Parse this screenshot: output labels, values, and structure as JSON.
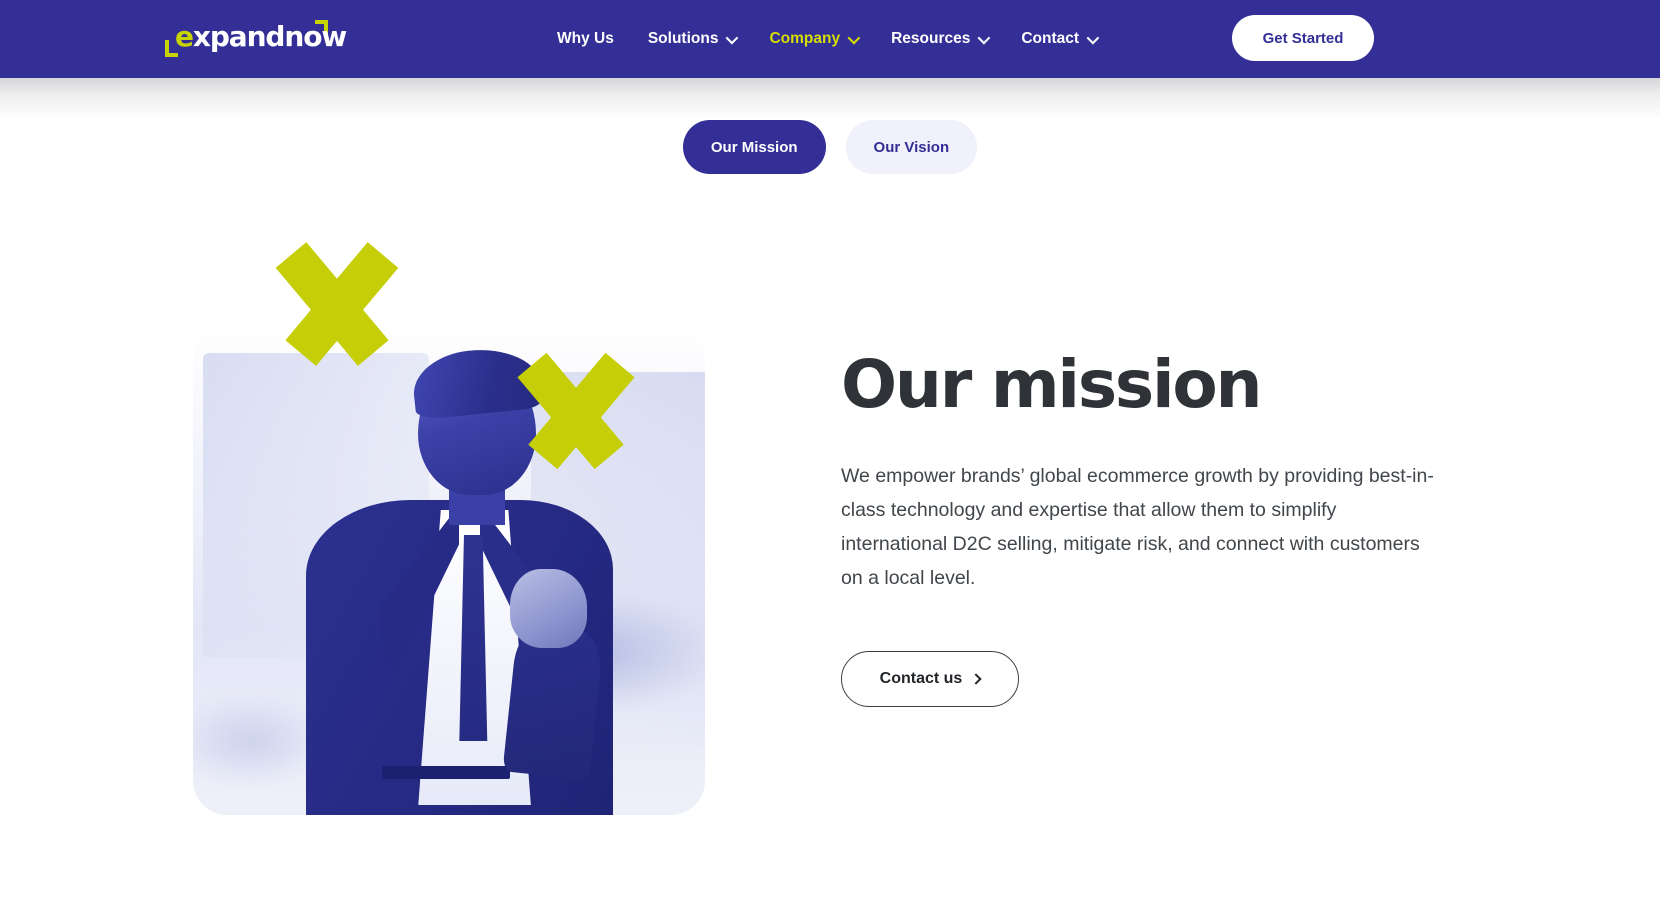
{
  "brand": {
    "logo_text_accent": "e",
    "logo_text_rest": "xpandnow",
    "accent_color": "#C8D400",
    "header_color": "#332F96"
  },
  "header": {
    "nav": [
      {
        "label": "Why Us",
        "has_dropdown": false,
        "active": false
      },
      {
        "label": "Solutions",
        "has_dropdown": true,
        "active": false
      },
      {
        "label": "Company",
        "has_dropdown": true,
        "active": true
      },
      {
        "label": "Resources",
        "has_dropdown": true,
        "active": false
      },
      {
        "label": "Contact",
        "has_dropdown": true,
        "active": false
      }
    ],
    "cta_label": "Get Started"
  },
  "tabs": [
    {
      "label": "Our Mission",
      "active": true
    },
    {
      "label": "Our Vision",
      "active": false
    }
  ],
  "main": {
    "heading": "Our mission",
    "paragraph": "We empower brands’ global ecommerce growth by providing best-in-class technology and expertise that allow them to simplify international D2C selling, mitigate risk, and connect with customers on a local level.",
    "button_label": "Contact us"
  },
  "visual": {
    "photo_alt": "Smiling businessman in a suit celebrating with a raised fist in an office",
    "chevron_color": "#C5CE06",
    "duotone_color": "#2A2F8C"
  }
}
